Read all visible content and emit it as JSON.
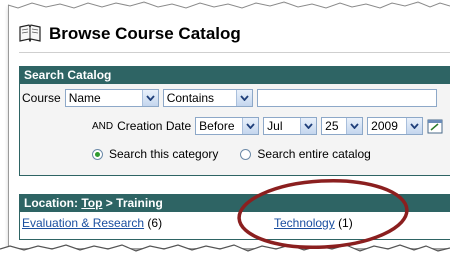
{
  "header": {
    "title": "Browse Course Catalog",
    "icon": "book-icon"
  },
  "search": {
    "title": "Search Catalog",
    "course_label": "Course",
    "field_select": "Name",
    "operator_select": "Contains",
    "query_value": "",
    "and_label": "AND",
    "creation_date_label": "Creation Date",
    "date_operator": "Before",
    "month": "Jul",
    "day": "25",
    "year": "2009",
    "scope_options": [
      {
        "label": "Search this category",
        "selected": true
      },
      {
        "label": "Search entire catalog",
        "selected": false
      }
    ]
  },
  "location": {
    "label": "Location:",
    "top_link": "Top",
    "separator": ">",
    "current": "Training",
    "categories": [
      {
        "name": "Evaluation & Research",
        "count": "(6)"
      },
      {
        "name": "Technology",
        "count": "(1)"
      }
    ]
  },
  "colors": {
    "panel_header": "#2e6464",
    "link": "#1a4fa0",
    "annotation": "#8b1f1f",
    "radio_selected": "#2f9b2f"
  }
}
